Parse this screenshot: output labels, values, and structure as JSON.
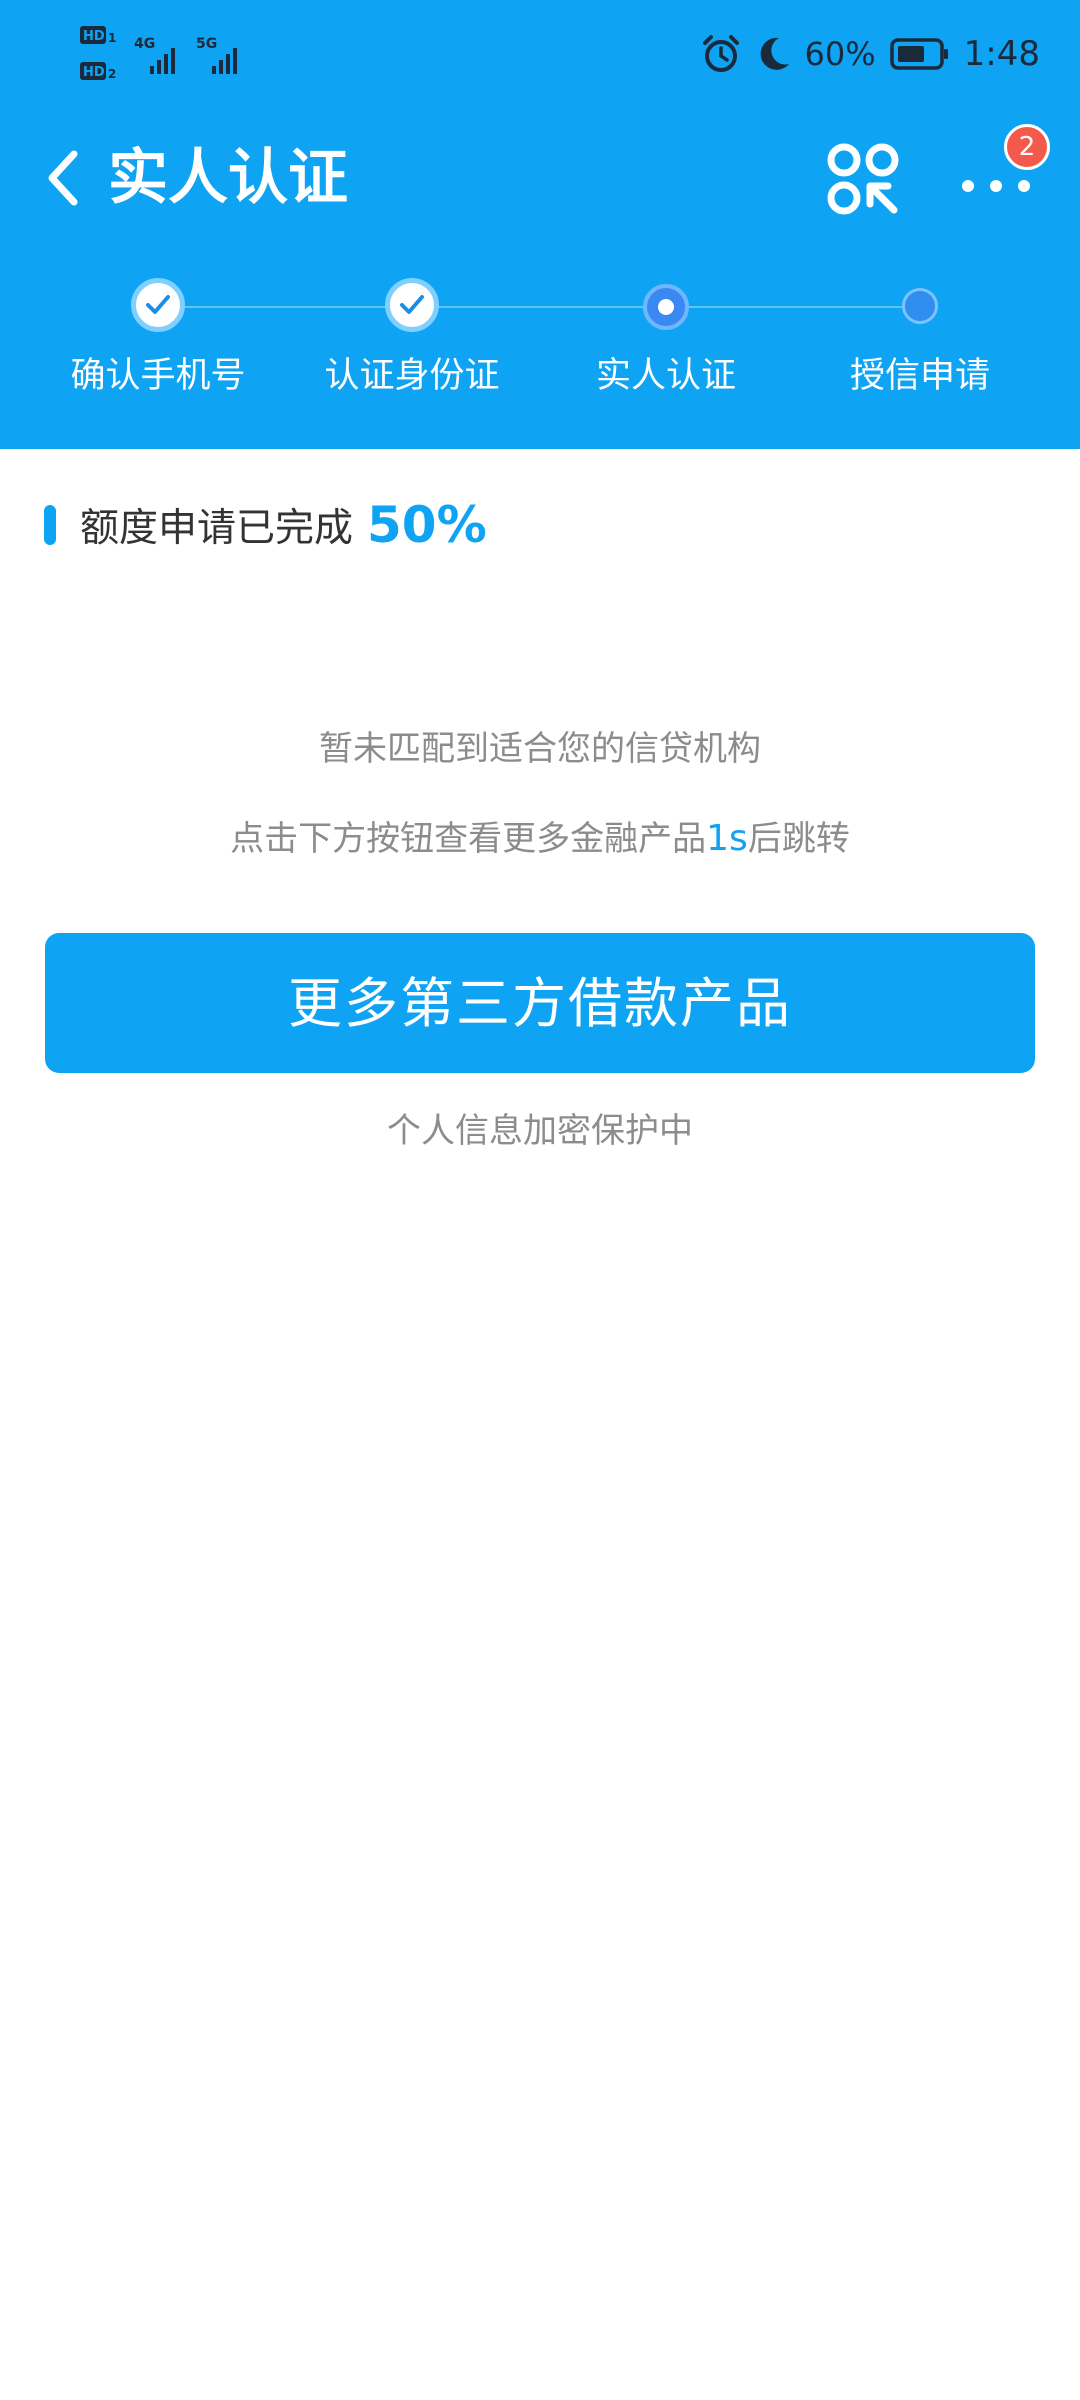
{
  "status_bar": {
    "time": "1:48",
    "battery_percent": "60%",
    "net_badges": [
      "HD",
      "HD",
      "4G",
      "5G"
    ],
    "icons": [
      "alarm-icon",
      "moon-icon",
      "battery-icon"
    ]
  },
  "nav": {
    "title": "实人认证",
    "badge_count": "2"
  },
  "steps": [
    {
      "label": "确认手机号",
      "state": "done"
    },
    {
      "label": "认证身份证",
      "state": "done"
    },
    {
      "label": "实人认证",
      "state": "current"
    },
    {
      "label": "授信申请",
      "state": "todo"
    }
  ],
  "progress": {
    "label": "额度申请已完成",
    "percent": "50%"
  },
  "messages": {
    "no_match": "暂未匹配到适合您的信贷机构",
    "redirect_prefix": "点击下方按钮查看更多金融产品",
    "countdown": "1s",
    "redirect_suffix": "后跳转"
  },
  "main_button": {
    "label": "更多第三方借款产品"
  },
  "footer_note": "个人信息加密保护中",
  "colors": {
    "brand": "#0fa3f4",
    "badge": "#f45a4b",
    "muted_text": "#8c8c8c"
  }
}
